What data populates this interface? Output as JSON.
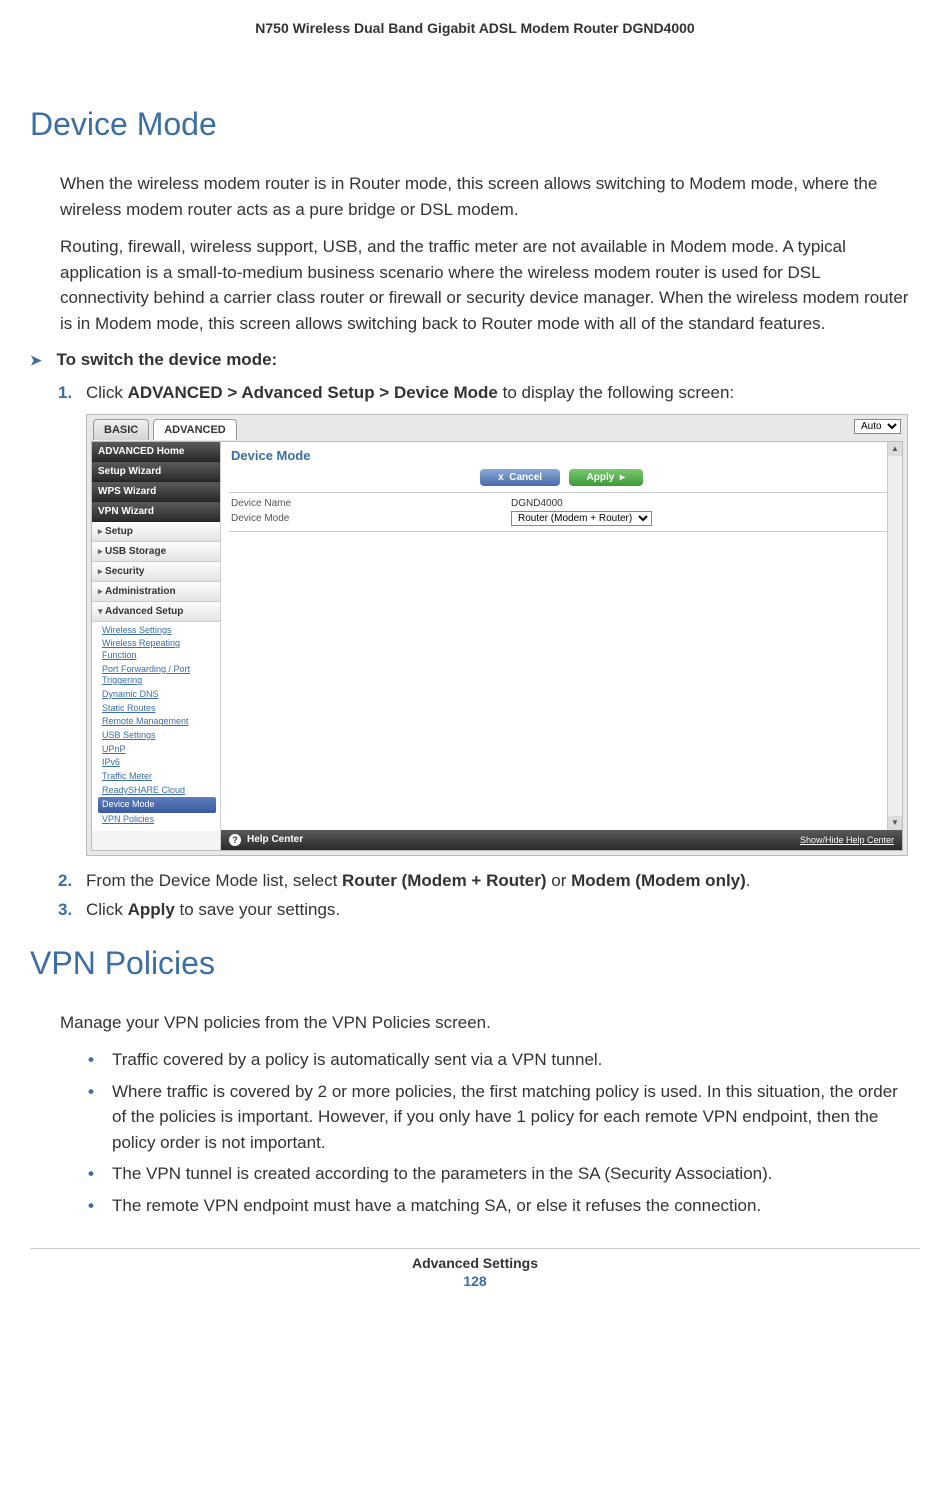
{
  "doc_header": "N750 Wireless Dual Band Gigabit ADSL Modem Router DGND4000",
  "section1_title": "Device Mode",
  "para1": "When the wireless modem router is in Router mode, this screen allows switching to Modem mode, where the wireless modem router acts as a pure bridge or DSL modem.",
  "para2": "Routing, firewall, wireless support, USB, and the traffic meter are not available in Modem mode. A typical application is a small-to-medium business scenario where the wireless modem router is used for DSL connectivity behind a carrier class router or firewall or security device manager. When the wireless modem router is in Modem mode, this screen allows switching back to Router mode with all of the standard features.",
  "proc_heading": "To switch the device mode:",
  "step1_num": "1.",
  "step1_a": "Click ",
  "step1_b": "ADVANCED > Advanced Setup > Device Mode",
  "step1_c": " to display the following screen:",
  "step2_num": "2.",
  "step2_a": "From the Device Mode list, select ",
  "step2_b": "Router (Modem + Router)",
  "step2_c": " or ",
  "step2_d": "Modem (Modem only)",
  "step2_e": ".",
  "step3_num": "3.",
  "step3_a": "Click ",
  "step3_b": "Apply",
  "step3_c": " to save your settings.",
  "section2_title": "VPN Policies",
  "para3": "Manage your VPN policies from the VPN Policies screen.",
  "b1": "Traffic covered by a policy is automatically sent via a VPN tunnel.",
  "b2": "Where traffic is covered by 2 or more policies, the first matching policy is used. In this situation, the order of the policies is important. However, if you only have 1 policy for each remote VPN endpoint, then the policy order is not important.",
  "b3": "The VPN tunnel is created according to the parameters in the SA (Security Association).",
  "b4": "The remote VPN endpoint must have a matching SA, or else it refuses the connection.",
  "bullet": "•",
  "footer_title": "Advanced Settings",
  "footer_page": "128",
  "ss": {
    "tab_basic": "BASIC",
    "tab_advanced": "ADVANCED",
    "auto": "Auto",
    "nav": {
      "home": "ADVANCED Home",
      "setup_wizard": "Setup Wizard",
      "wps_wizard": "WPS Wizard",
      "vpn_wizard": "VPN Wizard",
      "setup": "Setup",
      "usb": "USB Storage",
      "security": "Security",
      "admin": "Administration",
      "adv_setup": "Advanced Setup"
    },
    "sub": {
      "wireless_settings": "Wireless Settings",
      "wireless_repeating": "Wireless Repeating Function",
      "port_fwd": "Port Forwarding / Port Triggering",
      "ddns": "Dynamic DNS",
      "static_routes": "Static Routes",
      "remote_mgmt": "Remote Management",
      "usb_settings": "USB Settings",
      "upnp": "UPnP",
      "ipv6": "IPv6",
      "traffic_meter": "Traffic Meter",
      "readyshare": "ReadySHARE Cloud",
      "device_mode": "Device Mode",
      "vpn_policies": "VPN Policies"
    },
    "main_title": "Device Mode",
    "cancel": "Cancel",
    "apply": "Apply",
    "x": "x",
    "arrow": "▸",
    "device_name_label": "Device Name",
    "device_name_value": "DGND4000",
    "device_mode_label": "Device Mode",
    "device_mode_value": "Router (Modem + Router)",
    "help_center": "Help Center",
    "help_toggle": "Show/Hide Help Center",
    "scroll_up": "▲",
    "scroll_down": "▼"
  }
}
